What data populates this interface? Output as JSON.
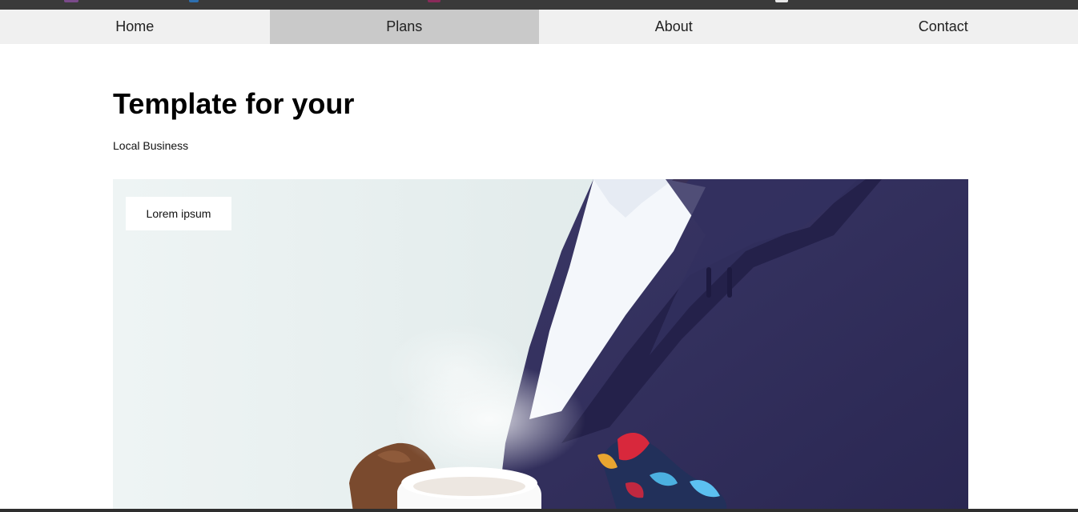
{
  "nav": {
    "items": [
      {
        "label": "Home"
      },
      {
        "label": "Plans"
      },
      {
        "label": "About"
      },
      {
        "label": "Contact"
      }
    ],
    "active": "Plans"
  },
  "hero": {
    "title": "Template for your",
    "subtitle": "Local Business",
    "badge": "Lorem ipsum"
  },
  "colors": {
    "top_strip": "#3a3a3a",
    "nav_background": "#f0f0f0",
    "nav_active": "#c9c9c9",
    "jacket": "#2f2c5a"
  }
}
